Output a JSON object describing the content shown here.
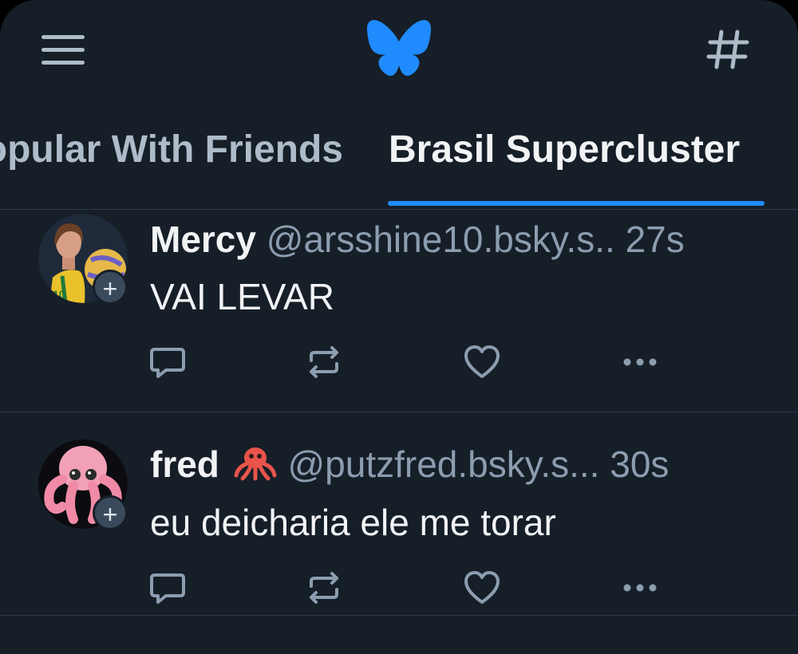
{
  "header": {
    "menu_icon": "hamburger-menu-icon",
    "logo_icon": "bluesky-butterfly-icon",
    "feeds_icon": "hashtag-icon",
    "accent_color": "#208bfe"
  },
  "tabs": [
    {
      "label": "Popular With Friends",
      "active": false
    },
    {
      "label": "Brasil Supercluster",
      "active": true
    }
  ],
  "posts": [
    {
      "display_name": "Mercy",
      "handle": "@arsshine10.bsky.s..",
      "time": "27s",
      "text": "VAI LEVAR",
      "follow_label": "+",
      "avatar_icon": "volleyball-player-avatar"
    },
    {
      "display_name": "fred",
      "name_emoji": "octopus-emoji-icon",
      "handle": "@putzfred.bsky.s...",
      "time": "30s",
      "text": "eu deicharia ele me torar",
      "follow_label": "+",
      "avatar_icon": "pink-octopus-avatar"
    }
  ],
  "actions": [
    "reply-icon",
    "repost-icon",
    "like-icon",
    "more-icon"
  ],
  "colors": {
    "background": "#161e27",
    "primary_text": "#f1f3f5",
    "secondary_text": "#8c9db0",
    "divider": "#2e3a47"
  }
}
